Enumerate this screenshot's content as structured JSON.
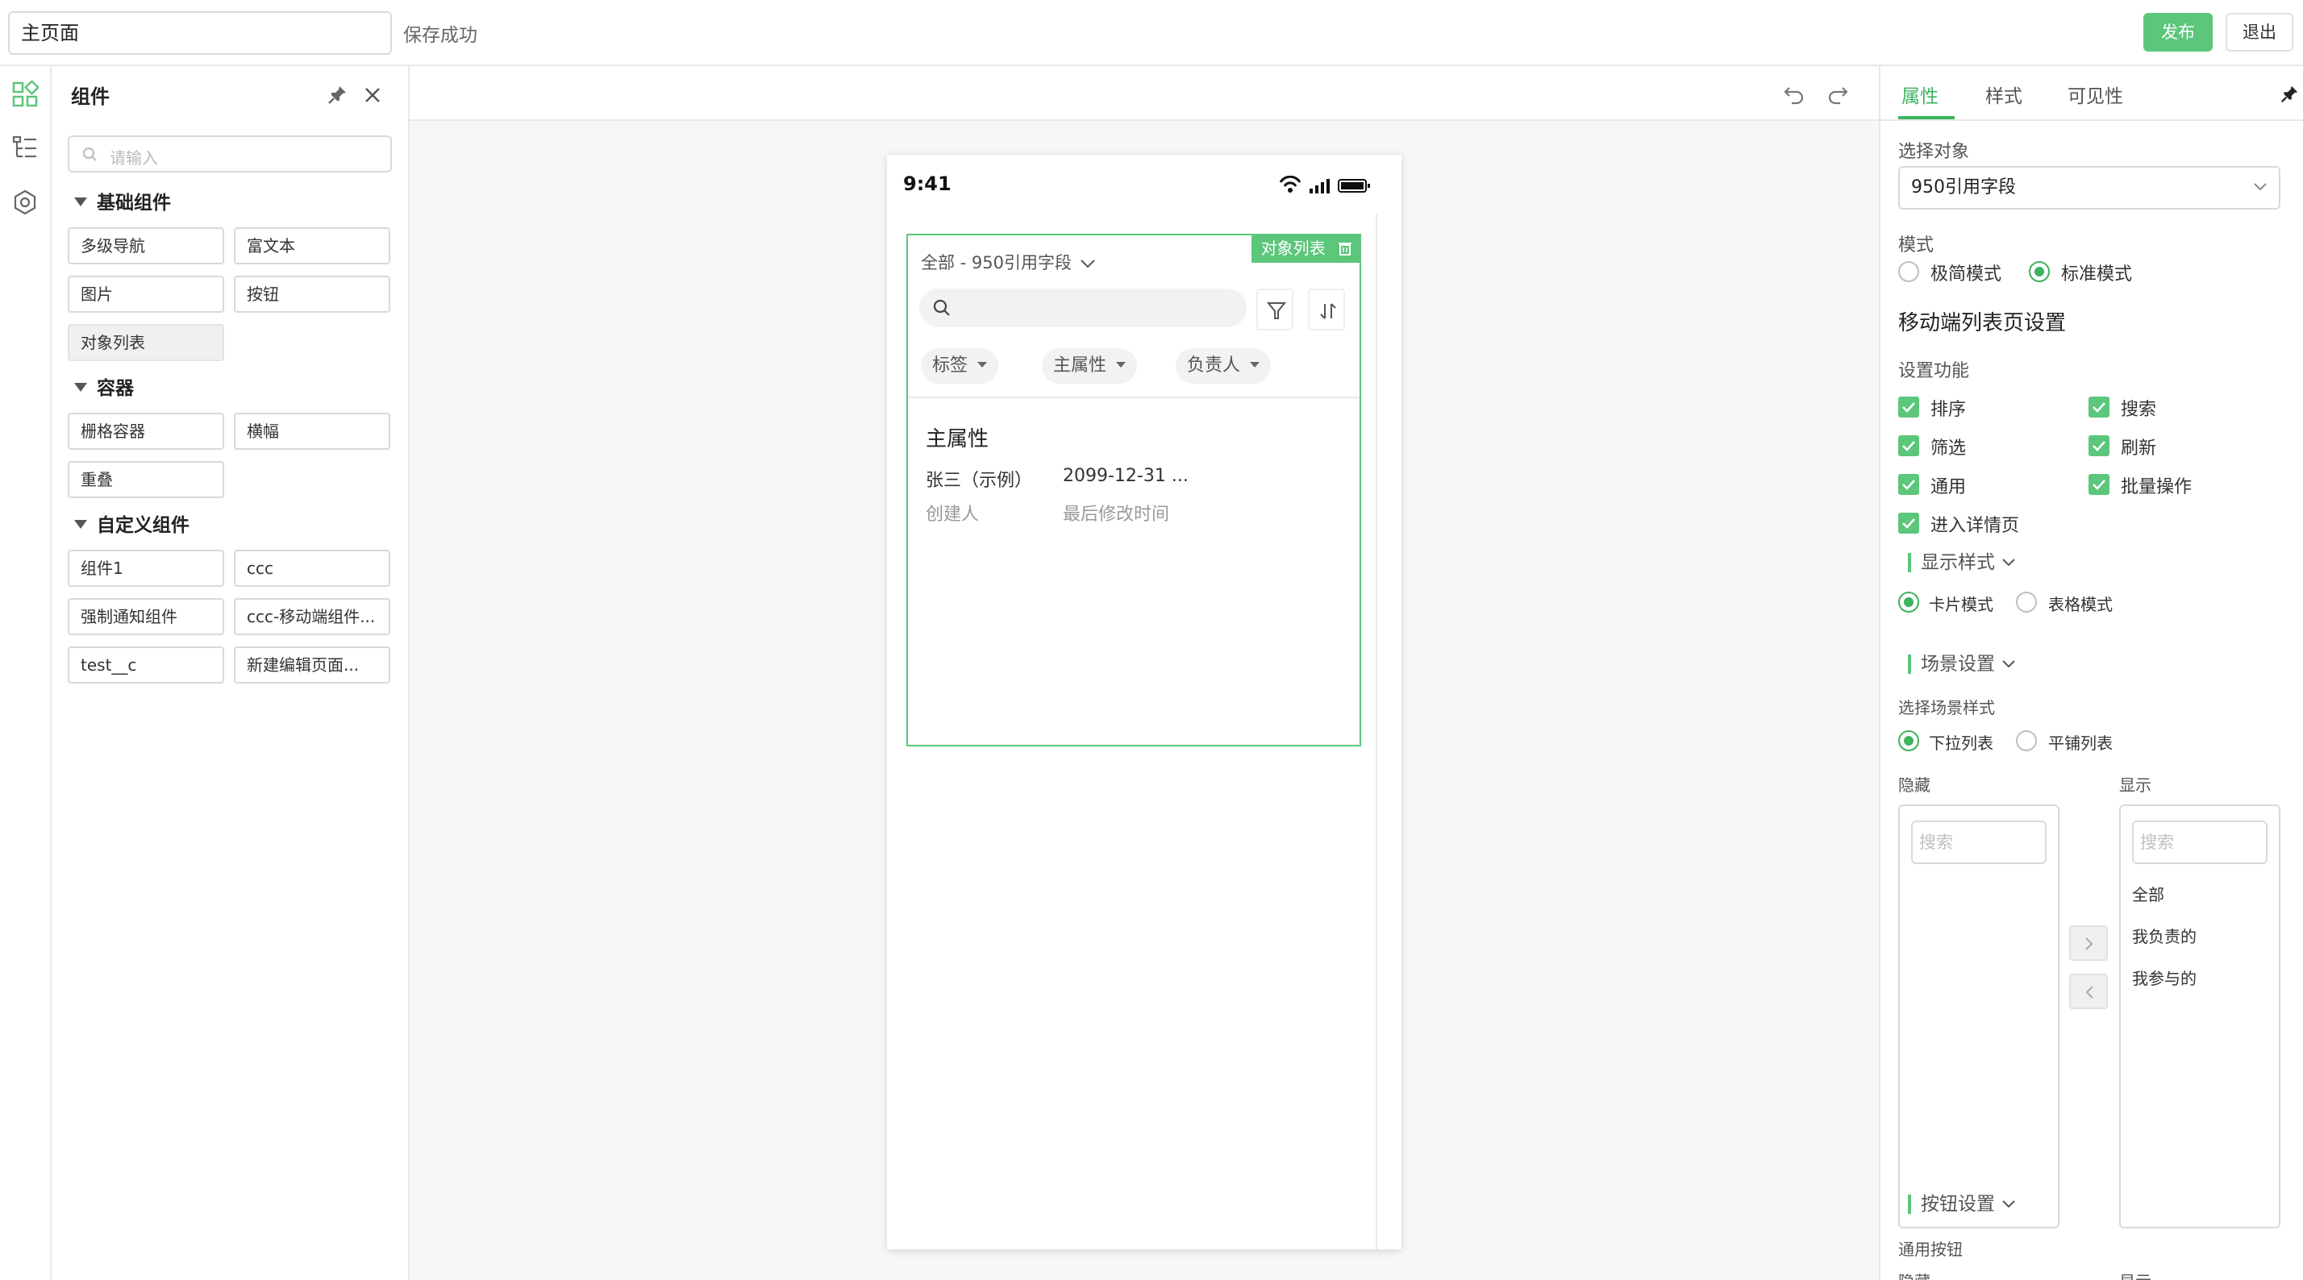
{
  "topbar": {
    "page_name": "主页面",
    "save_status": "保存成功",
    "publish_label": "发布",
    "exit_label": "退出"
  },
  "component_panel": {
    "title": "组件",
    "search_placeholder": "请输入",
    "groups": [
      {
        "title": "基础组件",
        "items": [
          "多级导航",
          "富文本",
          "图片",
          "按钮",
          "对象列表"
        ]
      },
      {
        "title": "容器",
        "items": [
          "栅格容器",
          "横幅",
          "重叠"
        ]
      },
      {
        "title": "自定义组件",
        "items": [
          "组件1",
          "ccc",
          "强制通知组件",
          "ccc-移动端组件...",
          "test__c",
          "新建编辑页面..."
        ]
      }
    ]
  },
  "phone": {
    "time": "9:41",
    "list_tag": "对象列表",
    "scene": "全部 - 950引用字段",
    "filters": [
      "标签",
      "主属性",
      "负责人"
    ],
    "card": {
      "title": "主属性",
      "value1": "张三（示例）",
      "value2": "2099-12-31 ...",
      "label1": "创建人",
      "label2": "最后修改时间"
    }
  },
  "props": {
    "tabs": [
      "属性",
      "样式",
      "可见性"
    ],
    "active_tab": "属性",
    "select_object_label": "选择对象",
    "select_object_value": "950引用字段",
    "mode_label": "模式",
    "mode_options": [
      "极简模式",
      "标准模式"
    ],
    "mode_selected": "标准模式",
    "section_title": "移动端列表页设置",
    "features_label": "设置功能",
    "features": [
      {
        "label": "排序",
        "checked": true
      },
      {
        "label": "搜索",
        "checked": true
      },
      {
        "label": "筛选",
        "checked": true
      },
      {
        "label": "刷新",
        "checked": true
      },
      {
        "label": "通用",
        "checked": true
      },
      {
        "label": "批量操作",
        "checked": true
      },
      {
        "label": "进入详情页",
        "checked": true
      }
    ],
    "display_style_title": "显示样式",
    "display_options": [
      "卡片模式",
      "表格模式"
    ],
    "display_selected": "卡片模式",
    "scene_settings_title": "场景设置",
    "scene_style_label": "选择场景样式",
    "scene_options": [
      "下拉列表",
      "平铺列表"
    ],
    "scene_selected": "下拉列表",
    "hidden_label": "隐藏",
    "shown_label": "显示",
    "transfer_search_placeholder": "搜索",
    "shown_items": [
      "全部",
      "我负责的",
      "我参与的"
    ],
    "button_settings_title": "按钮设置",
    "common_buttons_label": "通用按钮",
    "bottom_hidden_label": "隐藏",
    "bottom_shown_label": "显示"
  },
  "colors": {
    "accent": "#5cc67b",
    "accent_text": "#3db35f"
  }
}
